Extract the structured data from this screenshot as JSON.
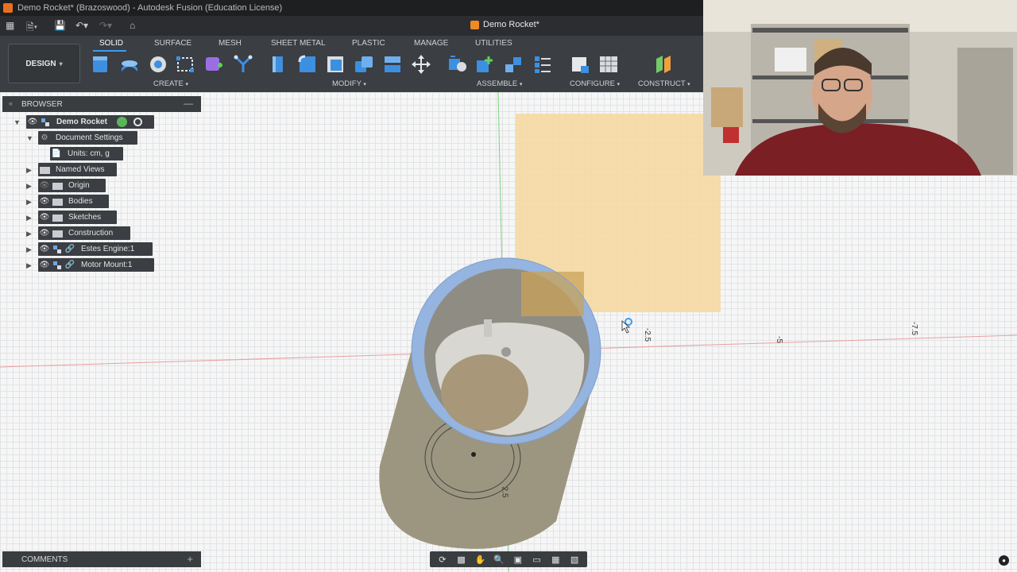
{
  "window": {
    "title": "Demo Rocket* (Brazoswood) - Autodesk Fusion (Education License)"
  },
  "document_tab": {
    "label": "Demo Rocket*"
  },
  "toolbar": {
    "workspace_label": "DESIGN",
    "tabs": [
      {
        "label": "SOLID",
        "active": true
      },
      {
        "label": "SURFACE"
      },
      {
        "label": "MESH"
      },
      {
        "label": "SHEET METAL"
      },
      {
        "label": "PLASTIC"
      },
      {
        "label": "MANAGE"
      },
      {
        "label": "UTILITIES"
      }
    ],
    "groups": [
      {
        "label": "CREATE"
      },
      {
        "label": "MODIFY"
      },
      {
        "label": "ASSEMBLE"
      },
      {
        "label": "CONFIGURE"
      },
      {
        "label": "CONSTRUCT"
      }
    ]
  },
  "browser": {
    "header": "BROWSER",
    "root": {
      "label": "Demo Rocket"
    },
    "items": [
      {
        "label": "Document Settings"
      },
      {
        "label": "Units: cm, g"
      },
      {
        "label": "Named Views"
      },
      {
        "label": "Origin"
      },
      {
        "label": "Bodies"
      },
      {
        "label": "Sketches"
      },
      {
        "label": "Construction"
      },
      {
        "label": "Estes Engine:1"
      },
      {
        "label": "Motor Mount:1"
      }
    ]
  },
  "comments": {
    "header": "COMMENTS"
  },
  "viewport": {
    "axis_labels": [
      "-2.5",
      "-5",
      "-7.5",
      "2.5"
    ],
    "colors": {
      "sketch_plane": "#f5d9a2",
      "ring": "#95b4e0",
      "body": "#9c9680"
    }
  }
}
